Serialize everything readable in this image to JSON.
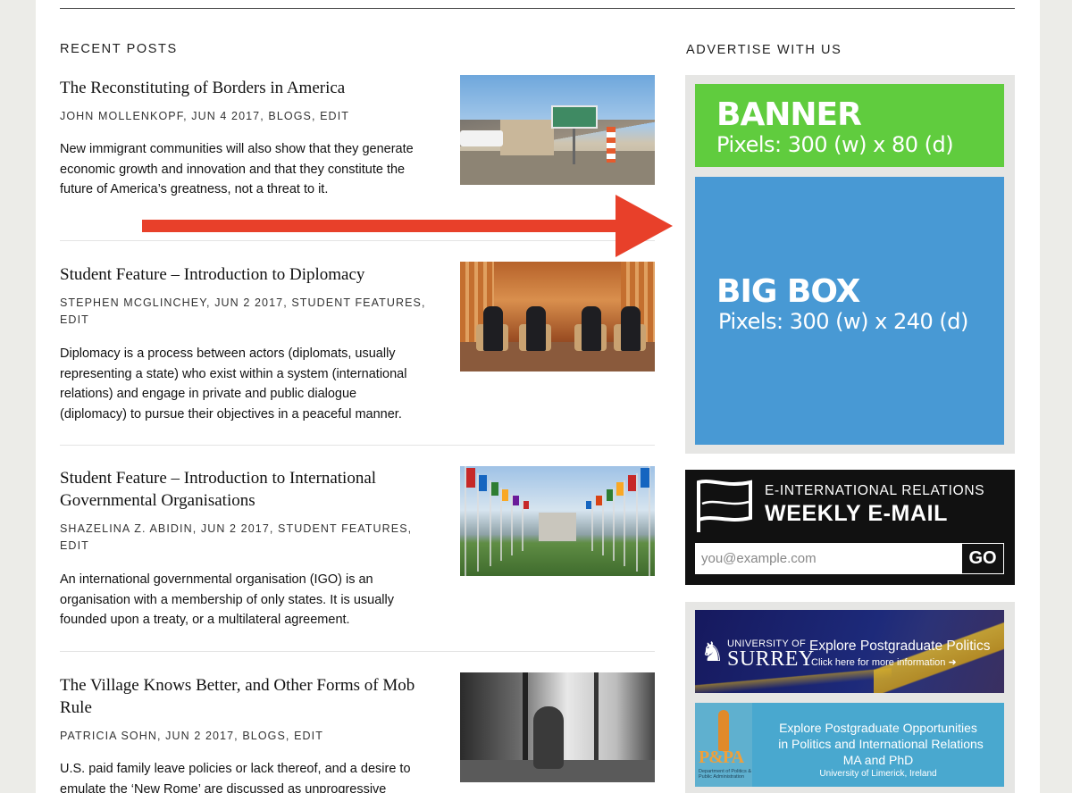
{
  "recent_posts": {
    "heading": "RECENT POSTS",
    "posts": [
      {
        "title": "The Reconstituting of Borders in America",
        "author": "JOHN MOLLENKOPF",
        "date": "JUN 4 2017",
        "category": "BLOGS",
        "edit": "EDIT",
        "excerpt": "New immigrant communities will also show that they generate economic growth and innovation and that they constitute the future of America’s greatness, not a threat to it."
      },
      {
        "title": "Student Feature – Introduction to Diplomacy",
        "author": "STEPHEN MCGLINCHEY",
        "date": "JUN 2 2017",
        "category": "STUDENT FEATURES",
        "edit": "EDIT",
        "excerpt": "Diplomacy is a process between actors (diplomats, usually representing a state) who exist within a system (international relations) and engage in private and public dialogue (diplomacy) to pursue their objectives in a peaceful manner."
      },
      {
        "title": "Student Feature – Introduction to International Governmental Organisations",
        "author": "SHAZELINA Z. ABIDIN",
        "date": "JUN 2 2017",
        "category": "STUDENT FEATURES",
        "edit": "EDIT",
        "excerpt": "An international governmental organisation (IGO) is an organisation with a membership of only states. It is usually founded upon a treaty, or a multilateral agreement."
      },
      {
        "title": "The Village Knows Better, and Other Forms of Mob Rule",
        "author": "PATRICIA SOHN",
        "date": "JUN 2 2017",
        "category": "BLOGS",
        "edit": "EDIT",
        "excerpt": "U.S. paid family leave policies or lack thereof, and a desire to emulate the ‘New Rome’ are discussed as unprogressive"
      }
    ]
  },
  "advertise": {
    "heading": "ADVERTISE WITH US",
    "banner": {
      "title": "BANNER",
      "size": "Pixels: 300 (w) x 80 (d)",
      "color": "#60cc3e"
    },
    "big_box": {
      "title": "BIG BOX",
      "size": "Pixels: 300 (w) x 240 (d)",
      "color": "#4899d4"
    }
  },
  "newsletter": {
    "line1": "E-INTERNATIONAL RELATIONS",
    "line2": "WEEKLY E-MAIL",
    "email_placeholder": "you@example.com",
    "go_label": "GO"
  },
  "promos": {
    "surrey": {
      "uni_small": "UNIVERSITY OF",
      "uni_big": "SURREY",
      "headline": "Explore Postgraduate Politics",
      "subline": "Click here for more information"
    },
    "limerick": {
      "logo_text": "P&PA",
      "dept_text": "Department of Politics & Public Administration",
      "line1": "Explore Postgraduate Opportunities",
      "line2": "in Politics and International Relations",
      "line3": "MA and PhD",
      "line4": "University of Limerick, Ireland"
    }
  },
  "colors": {
    "arrow": "#e8402a"
  }
}
